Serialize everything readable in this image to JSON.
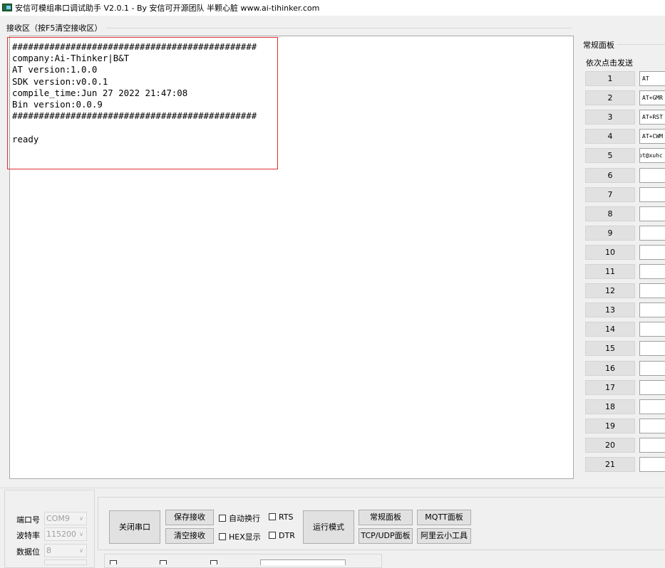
{
  "window": {
    "title": "安信可模组串口调试助手 V2.0.1 - By 安信可开源团队 半颗心脏 www.ai-tihinker.com",
    "icon": "app-icon"
  },
  "receive": {
    "label": "接收区（按F5清空接收区）",
    "text": "##############################################\ncompany:Ai-Thinker|B&T\nAT version:1.0.0\nSDK version:v0.0.1\ncompile_time:Jun 27 2022 21:47:08\nBin version:0.0.9\n##############################################\n\nready"
  },
  "panel": {
    "title": "常规面板",
    "seq_send": "依次点击发送",
    "rows": [
      {
        "num": "1",
        "cmd": "AT"
      },
      {
        "num": "2",
        "cmd": "AT+GMR"
      },
      {
        "num": "3",
        "cmd": "AT+RST"
      },
      {
        "num": "4",
        "cmd": "AT+CWM"
      },
      {
        "num": "5",
        "cmd": "pt@xuhc"
      },
      {
        "num": "6",
        "cmd": ""
      },
      {
        "num": "7",
        "cmd": ""
      },
      {
        "num": "8",
        "cmd": ""
      },
      {
        "num": "9",
        "cmd": ""
      },
      {
        "num": "10",
        "cmd": ""
      },
      {
        "num": "11",
        "cmd": ""
      },
      {
        "num": "12",
        "cmd": ""
      },
      {
        "num": "13",
        "cmd": ""
      },
      {
        "num": "14",
        "cmd": ""
      },
      {
        "num": "15",
        "cmd": ""
      },
      {
        "num": "16",
        "cmd": ""
      },
      {
        "num": "17",
        "cmd": ""
      },
      {
        "num": "18",
        "cmd": ""
      },
      {
        "num": "19",
        "cmd": ""
      },
      {
        "num": "20",
        "cmd": ""
      },
      {
        "num": "21",
        "cmd": ""
      }
    ]
  },
  "port": {
    "port_label": "端口号",
    "port_value": "COM9",
    "baud_label": "波特率",
    "baud_value": "115200",
    "databits_label": "数据位",
    "databits_value": "8"
  },
  "controls": {
    "close_port": "关闭串口",
    "save_recv": "保存接收",
    "clear_recv": "清空接收",
    "auto_wrap": "自动换行",
    "rts": "RTS",
    "hex_display": "HEX显示",
    "dtr": "DTR",
    "run_mode": "运行模式",
    "normal_panel": "常规面板",
    "mqtt_panel": "MQTT面板",
    "tcp_udp_panel": "TCP/UDP面板",
    "aliyun_tools": "阿里云小工具"
  }
}
